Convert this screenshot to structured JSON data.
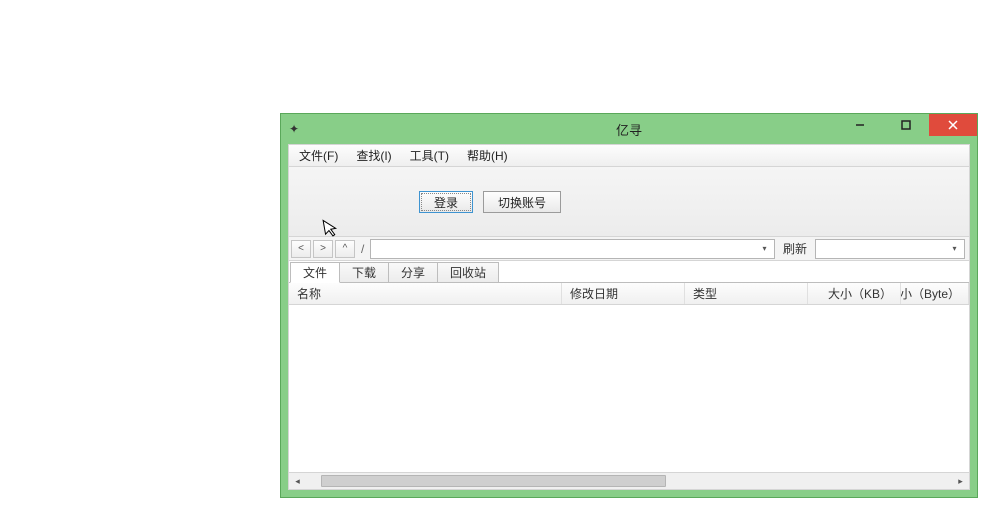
{
  "window": {
    "title": "亿寻"
  },
  "menubar": {
    "file": "文件(F)",
    "find": "查找(I)",
    "tools": "工具(T)",
    "help": "帮助(H)"
  },
  "buttons": {
    "login": "登录",
    "switch_account": "切换账号"
  },
  "nav": {
    "back": "<",
    "forward": ">",
    "up": "^",
    "path_sep": "/",
    "refresh": "刷新"
  },
  "tabs": {
    "files": "文件",
    "downloads": "下载",
    "share": "分享",
    "recycle": "回收站"
  },
  "columns": {
    "name": "名称",
    "modified": "修改日期",
    "type": "类型",
    "size_kb": "大小（KB）",
    "size_byte": "大小（Byte）"
  }
}
